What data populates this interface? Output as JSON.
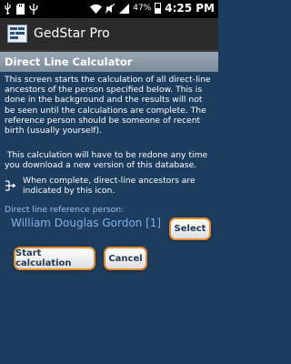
{
  "status_bar": {
    "battery_percent": "47%",
    "battery_level": 0.47,
    "time": "4:25 PM",
    "icons": [
      "usb-icon",
      "sd-card-icon",
      "wifi-icon",
      "mute-icon",
      "signal-icon",
      "battery-icon"
    ]
  },
  "app_bar": {
    "title": "GedStar Pro",
    "icon": "gedstar-app-icon"
  },
  "section": {
    "title": "Direct Line Calculator"
  },
  "content": {
    "intro": "This screen starts the calculation of all direct-line ancestors of the person specified below. This is done in the background and the results will not be seen until the calculations are complete. The reference person should be someone of recent birth (usually yourself).",
    "redo_note": "This calculation will have to be redone any time you download a new version of this database.",
    "legend_text": "When complete, direct-line ancestors are indicated by this icon.",
    "legend_icon": "direct-line-ancestor-icon",
    "reference_label": "Direct line reference person:",
    "reference_person": "William Douglas Gordon [1]"
  },
  "buttons": {
    "select": "Select",
    "start": "Start calculation",
    "cancel": "Cancel"
  },
  "colors": {
    "background": "#1d3d5f",
    "button_border": "#e58a2c",
    "link_text": "#7fb1e6"
  }
}
